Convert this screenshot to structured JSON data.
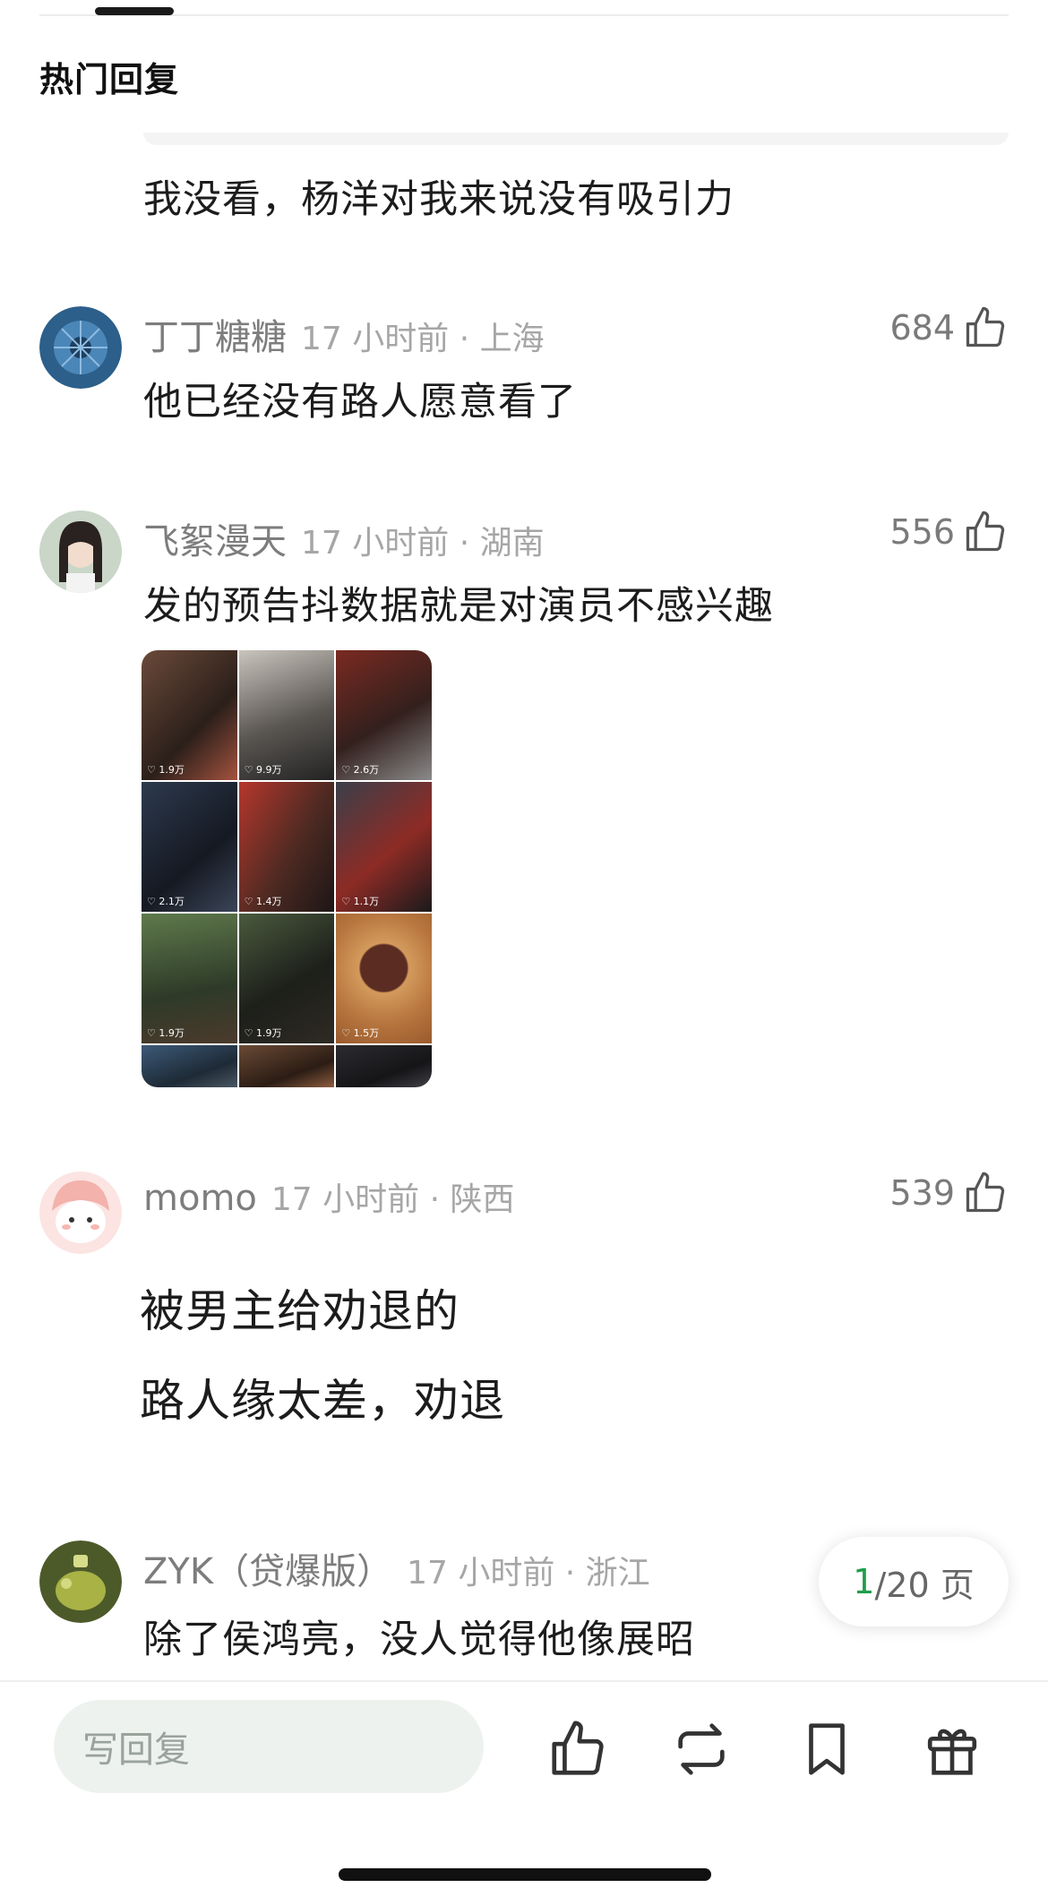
{
  "header": {
    "title": "热门回复"
  },
  "quoted_reply": {
    "text": "我没看，杨洋对我来说没有吸引力"
  },
  "comments": [
    {
      "username": "丁丁糖糖",
      "time_location": "17 小时前 · 上海",
      "likes": "684",
      "lines": [
        "他已经没有路人愿意看了"
      ]
    },
    {
      "username": "飞絮漫天",
      "time_location": "17 小时前 · 湖南",
      "likes": "556",
      "lines": [
        "发的预告抖数据就是对演员不感兴趣"
      ],
      "image_grid": [
        "1.9万",
        "9.9万",
        "2.6万",
        "2.1万",
        "1.4万",
        "1.1万",
        "1.9万",
        "1.9万",
        "1.5万",
        "",
        "",
        ""
      ]
    },
    {
      "username": "momo",
      "time_location": "17 小时前 · 陕西",
      "likes": "539",
      "lines": [
        "被男主给劝退的",
        "路人缘太差，劝退"
      ]
    },
    {
      "username": "ZYK（贷爆版）",
      "time_location": "17 小时前 · 浙江",
      "likes": "",
      "lines": [
        "除了侯鸿亮，没人觉得他像展昭"
      ]
    }
  ],
  "pagination": {
    "current": "1",
    "rest": "/20 页"
  },
  "bottom_bar": {
    "reply_placeholder": "写回复",
    "icons": [
      "thumbs-up-icon",
      "repost-icon",
      "bookmark-icon",
      "gift-icon"
    ]
  },
  "colors": {
    "accent_green": "#1e9e4a",
    "meta_grey": "#a6a6a6",
    "input_bg": "#eef2ef"
  }
}
